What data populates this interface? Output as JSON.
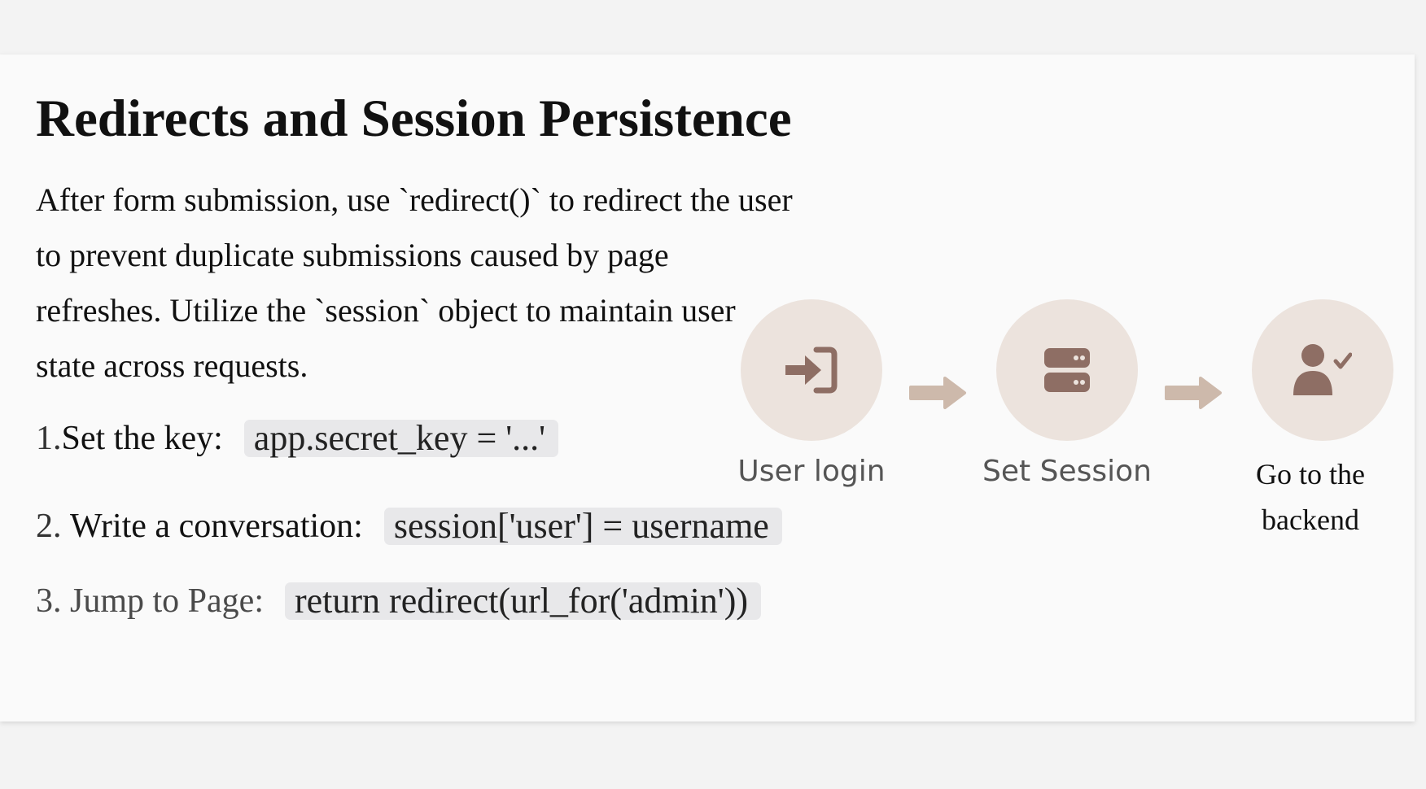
{
  "slide": {
    "title": "Redirects and Session Persistence",
    "description": "After form submission, use `redirect()` to redirect the user to prevent duplicate submissions caused by page refreshes. Utilize the `session` object to maintain user state across requests.",
    "steps": [
      {
        "number": "1.",
        "label": "Set the key:",
        "code": "app.secret_key = '...'"
      },
      {
        "number": "2.",
        "label": "Write a conversation:",
        "code": "session['user'] = username"
      },
      {
        "number": "3.",
        "label": "Jump to Page:",
        "code": "return redirect(url_for('admin'))"
      }
    ]
  },
  "flow": {
    "nodes": [
      {
        "label": "User login",
        "icon": "login-icon"
      },
      {
        "label": "Set Session",
        "icon": "server-icon"
      },
      {
        "label": "Go to the backend",
        "icon": "user-check-icon"
      }
    ],
    "colors": {
      "circle": "#ece3dd",
      "icon": "#8e6e64",
      "arrow": "#cdb9ab"
    }
  }
}
